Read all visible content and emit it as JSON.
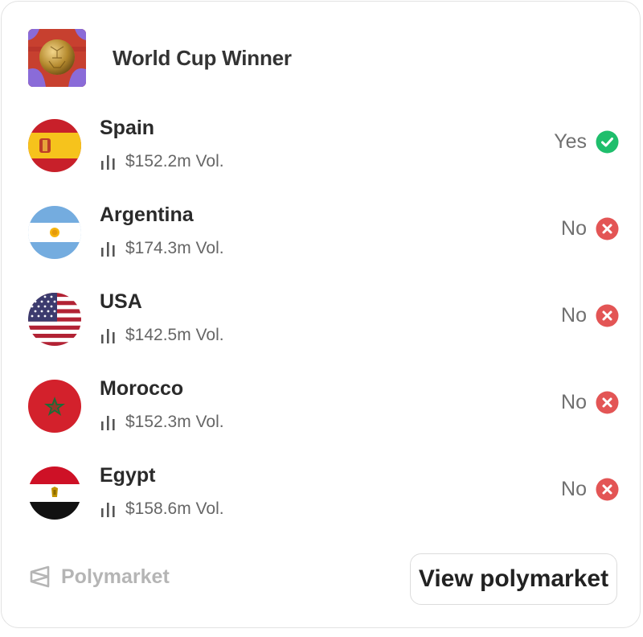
{
  "event": {
    "title": "World Cup Winner",
    "thumbnail_icon": "soccer-ball-icon"
  },
  "outcomes": [
    {
      "country": "Spain",
      "volume": "$152.2m Vol.",
      "result": "Yes",
      "status": "yes",
      "status_icon": "check-circle-icon",
      "status_color": "#1fbe6c"
    },
    {
      "country": "Argentina",
      "volume": "$174.3m Vol.",
      "result": "No",
      "status": "no",
      "status_icon": "x-circle-icon",
      "status_color": "#e35555"
    },
    {
      "country": "USA",
      "volume": "$142.5m Vol.",
      "result": "No",
      "status": "no",
      "status_icon": "x-circle-icon",
      "status_color": "#e35555"
    },
    {
      "country": "Morocco",
      "volume": "$152.3m Vol.",
      "result": "No",
      "status": "no",
      "status_icon": "x-circle-icon",
      "status_color": "#e35555"
    },
    {
      "country": "Egypt",
      "volume": "$158.6m Vol.",
      "result": "No",
      "status": "no",
      "status_icon": "x-circle-icon",
      "status_color": "#e35555"
    }
  ],
  "footer": {
    "brand": "Polymarket",
    "brand_icon": "polymarket-logo-icon",
    "button_label": "View polymarket"
  },
  "colors": {
    "yes": "#1fbe6c",
    "no": "#e35555",
    "brand_muted": "#b5b5b5"
  }
}
